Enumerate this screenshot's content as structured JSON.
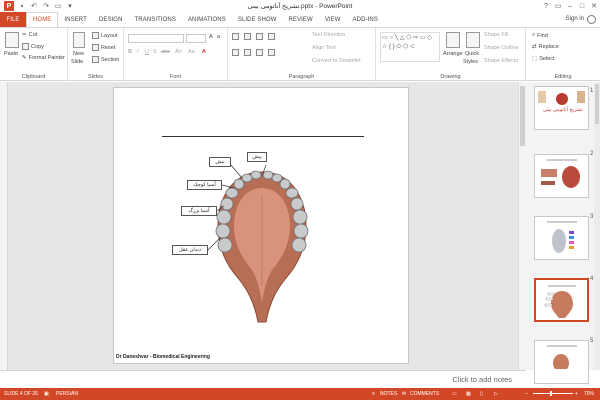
{
  "window": {
    "title": "تشريح آناتومی بينی.pptx - PowerPoint",
    "controls": [
      "?",
      "▭",
      "–",
      "□",
      "✕"
    ]
  },
  "tabs": {
    "file": "FILE",
    "items": [
      "HOME",
      "INSERT",
      "DESIGN",
      "TRANSITIONS",
      "ANIMATIONS",
      "SLIDE SHOW",
      "REVIEW",
      "VIEW",
      "ADD-INS"
    ],
    "sign_in": "Sign in"
  },
  "ribbon": {
    "clipboard": {
      "label": "Clipboard",
      "paste": "Paste",
      "cut": "Cut",
      "copy": "Copy",
      "format_painter": "Format Painter"
    },
    "slides": {
      "label": "Slides",
      "new_slide": "New",
      "new_slide2": "Slide",
      "layout": "Layout",
      "reset": "Reset",
      "section": "Section"
    },
    "font": {
      "label": "Font",
      "buttons": [
        "B",
        "I",
        "U",
        "S",
        "abc",
        "AV",
        "Aa",
        "A"
      ]
    },
    "paragraph": {
      "label": "Paragraph",
      "text_direction": "Text Direction",
      "align_text": "Align Text",
      "convert_smartart": "Convert to SmartArt"
    },
    "drawing": {
      "label": "Drawing",
      "arrange": "Arrange",
      "quick_styles": "Quick",
      "quick_styles2": "Styles",
      "shape_fill": "Shape Fill",
      "shape_outline": "Shape Outline",
      "shape_effects": "Shape Effects"
    },
    "editing": {
      "label": "Editing",
      "find": "Find",
      "replace": "Replace",
      "select": "Select"
    }
  },
  "slide": {
    "labels": [
      "پیش",
      "نیش",
      "آسیا کوچک",
      "آسیا بزرگ",
      "دندان عقل"
    ],
    "footer": "Dr Daneshvar - Biomedical Engineering"
  },
  "thumbnails": {
    "numbers": [
      "1",
      "2",
      "3",
      "4",
      "5"
    ],
    "first_title": "تشريح آناتومی بينی",
    "selected_index": 4
  },
  "notes": {
    "placeholder": "Click to add notes"
  },
  "status": {
    "slide_info": "SLIDE 4 OF 26",
    "language": "PERSIAN",
    "notes": "NOTES",
    "comments": "COMMENTS",
    "zoom": "70%"
  },
  "colors": {
    "accent": "#d24726",
    "tooth": "#c7c9cb",
    "palate": "#c77b5e"
  }
}
